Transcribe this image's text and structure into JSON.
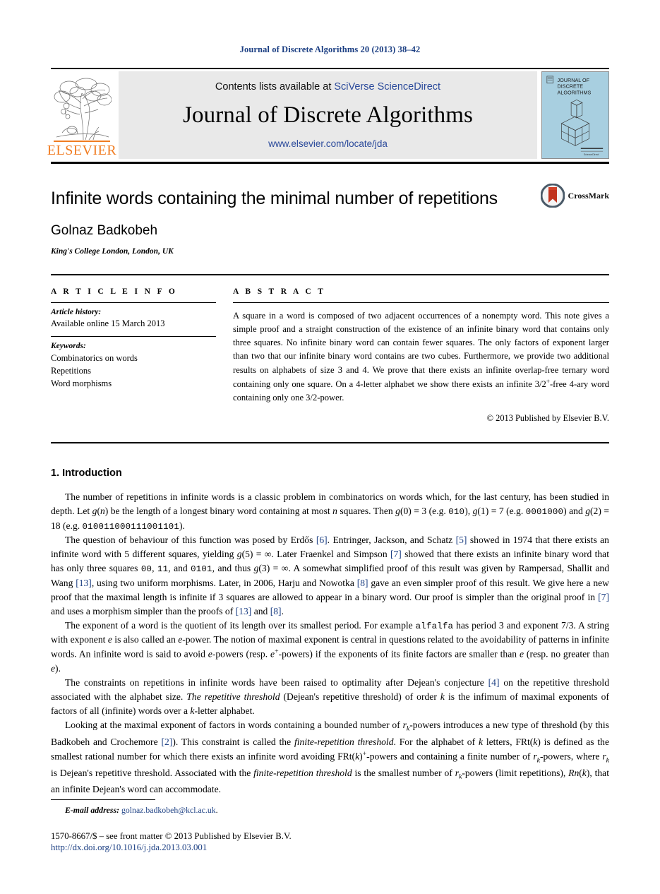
{
  "running_head": "Journal of Discrete Algorithms 20 (2013) 38–42",
  "masthead": {
    "contents_prefix": "Contents lists available at ",
    "sciencedirect_link": "SciVerse ScienceDirect",
    "journal_name": "Journal of Discrete Algorithms",
    "journal_url": "www.elsevier.com/locate/jda",
    "publisher_wordmark": "ELSEVIER",
    "cover_title_lines": [
      "JOURNAL OF",
      "DISCRETE",
      "ALGORITHMS"
    ],
    "link_color": "#2b4a9b",
    "publisher_color": "#f07c22",
    "cover_bg": "#a8cfe0"
  },
  "article": {
    "title": "Infinite words containing the minimal number of repetitions",
    "author": "Golnaz Badkobeh",
    "affiliation": "King's College London, London, UK",
    "crossmark_label": "CrossMark"
  },
  "info": {
    "heading": "A R T I C L E    I N F O",
    "history_label": "Article history:",
    "history_value": "Available online 15 March 2013",
    "keywords_label": "Keywords:",
    "keywords": [
      "Combinatorics on words",
      "Repetitions",
      "Word morphisms"
    ]
  },
  "abstract": {
    "heading": "A B S T R A C T",
    "paragraph_parts": [
      {
        "t": "text",
        "v": "A square in a word is composed of two adjacent occurrences of a nonempty word. This note gives a simple proof and a straight construction of the existence of an infinite binary word that contains only three squares. No infinite binary word can contain fewer squares. The only factors of exponent larger than two that our infinite binary word contains are two cubes. Furthermore, we provide two additional results on alphabets of size 3 and 4. We prove that there exists an infinite overlap-free ternary word containing only one square. On a 4-letter alphabet we show there exists an infinite 3/2"
      },
      {
        "t": "sup",
        "v": "+"
      },
      {
        "t": "text",
        "v": "-free 4-ary word containing only one 3/2-power."
      }
    ],
    "copyright": "© 2013 Published by Elsevier B.V."
  },
  "body": {
    "section_number_title": "1. Introduction",
    "paragraphs": [
      [
        {
          "t": "text",
          "v": "The number of repetitions in infinite words is a classic problem in combinatorics on words which, for the last century, has been studied in depth. Let "
        },
        {
          "t": "mi",
          "v": "g"
        },
        {
          "t": "text",
          "v": "("
        },
        {
          "t": "mi",
          "v": "n"
        },
        {
          "t": "text",
          "v": ") be the length of a longest binary word containing at most "
        },
        {
          "t": "mi",
          "v": "n"
        },
        {
          "t": "text",
          "v": " squares. Then "
        },
        {
          "t": "mi",
          "v": "g"
        },
        {
          "t": "text",
          "v": "(0) = 3 (e.g. "
        },
        {
          "t": "mono",
          "v": "010"
        },
        {
          "t": "text",
          "v": "), "
        },
        {
          "t": "mi",
          "v": "g"
        },
        {
          "t": "text",
          "v": "(1) = 7 (e.g. "
        },
        {
          "t": "mono",
          "v": "0001000"
        },
        {
          "t": "text",
          "v": ") and "
        },
        {
          "t": "mi",
          "v": "g"
        },
        {
          "t": "text",
          "v": "(2) = 18 (e.g. "
        },
        {
          "t": "mono",
          "v": "010011000111001101"
        },
        {
          "t": "text",
          "v": ")."
        }
      ],
      [
        {
          "t": "text",
          "v": "The question of behaviour of this function was posed by Erdős "
        },
        {
          "t": "ref",
          "v": "[6]"
        },
        {
          "t": "text",
          "v": ". Entringer, Jackson, and Schatz "
        },
        {
          "t": "ref",
          "v": "[5]"
        },
        {
          "t": "text",
          "v": " showed in 1974 that there exists an infinite word with 5 different squares, yielding "
        },
        {
          "t": "mi",
          "v": "g"
        },
        {
          "t": "text",
          "v": "(5) = ∞. Later Fraenkel and Simpson "
        },
        {
          "t": "ref",
          "v": "[7]"
        },
        {
          "t": "text",
          "v": " showed that there exists an infinite binary word that has only three squares "
        },
        {
          "t": "mono",
          "v": "00"
        },
        {
          "t": "text",
          "v": ", "
        },
        {
          "t": "mono",
          "v": "11"
        },
        {
          "t": "text",
          "v": ", and "
        },
        {
          "t": "mono",
          "v": "0101"
        },
        {
          "t": "text",
          "v": ", and thus "
        },
        {
          "t": "mi",
          "v": "g"
        },
        {
          "t": "text",
          "v": "(3) = ∞. A somewhat simplified proof of this result was given by Rampersad, Shallit and Wang "
        },
        {
          "t": "ref",
          "v": "[13]"
        },
        {
          "t": "text",
          "v": ", using two uniform morphisms. Later, in 2006, Harju and Nowotka "
        },
        {
          "t": "ref",
          "v": "[8]"
        },
        {
          "t": "text",
          "v": " gave an even simpler proof of this result. We give here a new proof that the maximal length is infinite if 3 squares are allowed to appear in a binary word. Our proof is simpler than the original proof in "
        },
        {
          "t": "ref",
          "v": "[7]"
        },
        {
          "t": "text",
          "v": " and uses a morphism simpler than the proofs of "
        },
        {
          "t": "ref",
          "v": "[13]"
        },
        {
          "t": "text",
          "v": " and "
        },
        {
          "t": "ref",
          "v": "[8]"
        },
        {
          "t": "text",
          "v": "."
        }
      ],
      [
        {
          "t": "text",
          "v": "The exponent of a word is the quotient of its length over its smallest period. For example "
        },
        {
          "t": "mono",
          "v": "alfalfa"
        },
        {
          "t": "text",
          "v": " has period 3 and exponent 7/3. A string with exponent "
        },
        {
          "t": "mi",
          "v": "e"
        },
        {
          "t": "text",
          "v": " is also called an "
        },
        {
          "t": "mi",
          "v": "e"
        },
        {
          "t": "text",
          "v": "-power. The notion of maximal exponent is central in questions related to the avoidability of patterns in infinite words. An infinite word is said to avoid "
        },
        {
          "t": "mi",
          "v": "e"
        },
        {
          "t": "text",
          "v": "-powers (resp. "
        },
        {
          "t": "mi",
          "v": "e"
        },
        {
          "t": "sup",
          "v": "+"
        },
        {
          "t": "text",
          "v": "-powers) if the exponents of its finite factors are smaller than "
        },
        {
          "t": "mi",
          "v": "e"
        },
        {
          "t": "text",
          "v": " (resp. no greater than "
        },
        {
          "t": "mi",
          "v": "e"
        },
        {
          "t": "text",
          "v": ")."
        }
      ],
      [
        {
          "t": "text",
          "v": "The constraints on repetitions in infinite words have been raised to optimality after Dejean's conjecture "
        },
        {
          "t": "ref",
          "v": "[4]"
        },
        {
          "t": "text",
          "v": " on the repetitive threshold associated with the alphabet size. "
        },
        {
          "t": "em",
          "v": "The repetitive threshold"
        },
        {
          "t": "text",
          "v": " (Dejean's repetitive threshold) of order "
        },
        {
          "t": "mi",
          "v": "k"
        },
        {
          "t": "text",
          "v": " is the infimum of maximal exponents of factors of all (infinite) words over a "
        },
        {
          "t": "mi",
          "v": "k"
        },
        {
          "t": "text",
          "v": "-letter alphabet."
        }
      ],
      [
        {
          "t": "text",
          "v": "Looking at the maximal exponent of factors in words containing a bounded number of "
        },
        {
          "t": "mi",
          "v": "r"
        },
        {
          "t": "sub_i",
          "v": "k"
        },
        {
          "t": "text",
          "v": "-powers introduces a new type of threshold (by this Badkobeh and Crochemore "
        },
        {
          "t": "ref",
          "v": "[2]"
        },
        {
          "t": "text",
          "v": "). This constraint is called the "
        },
        {
          "t": "em",
          "v": "finite-repetition threshold"
        },
        {
          "t": "text",
          "v": ". For the alphabet of "
        },
        {
          "t": "mi",
          "v": "k"
        },
        {
          "t": "text",
          "v": " letters, FRt("
        },
        {
          "t": "mi",
          "v": "k"
        },
        {
          "t": "text",
          "v": ") is defined as the smallest rational number for which there exists an infinite word avoiding FRt("
        },
        {
          "t": "mi",
          "v": "k"
        },
        {
          "t": "text",
          "v": ")"
        },
        {
          "t": "sup",
          "v": "+"
        },
        {
          "t": "text",
          "v": "-powers and containing a finite number of "
        },
        {
          "t": "mi",
          "v": "r"
        },
        {
          "t": "sub_i",
          "v": "k"
        },
        {
          "t": "text",
          "v": "-powers, where "
        },
        {
          "t": "mi",
          "v": "r"
        },
        {
          "t": "sub_i",
          "v": "k"
        },
        {
          "t": "text",
          "v": " is Dejean's repetitive threshold. Associated with the "
        },
        {
          "t": "em",
          "v": "finite-repetition threshold"
        },
        {
          "t": "text",
          "v": " is the smallest number of "
        },
        {
          "t": "mi",
          "v": "r"
        },
        {
          "t": "sub_i",
          "v": "k"
        },
        {
          "t": "text",
          "v": "-powers (limit repetitions), "
        },
        {
          "t": "mi",
          "v": "Rn"
        },
        {
          "t": "text",
          "v": "("
        },
        {
          "t": "mi",
          "v": "k"
        },
        {
          "t": "text",
          "v": "), that an infinite Dejean's word can accommodate."
        }
      ]
    ]
  },
  "footer": {
    "email_label": "E-mail address:",
    "email": "golnaz.badkobeh@kcl.ac.uk",
    "email_suffix": ".",
    "issn_line": "1570-8667/$ – see front matter  © 2013 Published by Elsevier B.V.",
    "doi": "http://dx.doi.org/10.1016/j.jda.2013.03.001",
    "link_color": "#1c3f83"
  }
}
